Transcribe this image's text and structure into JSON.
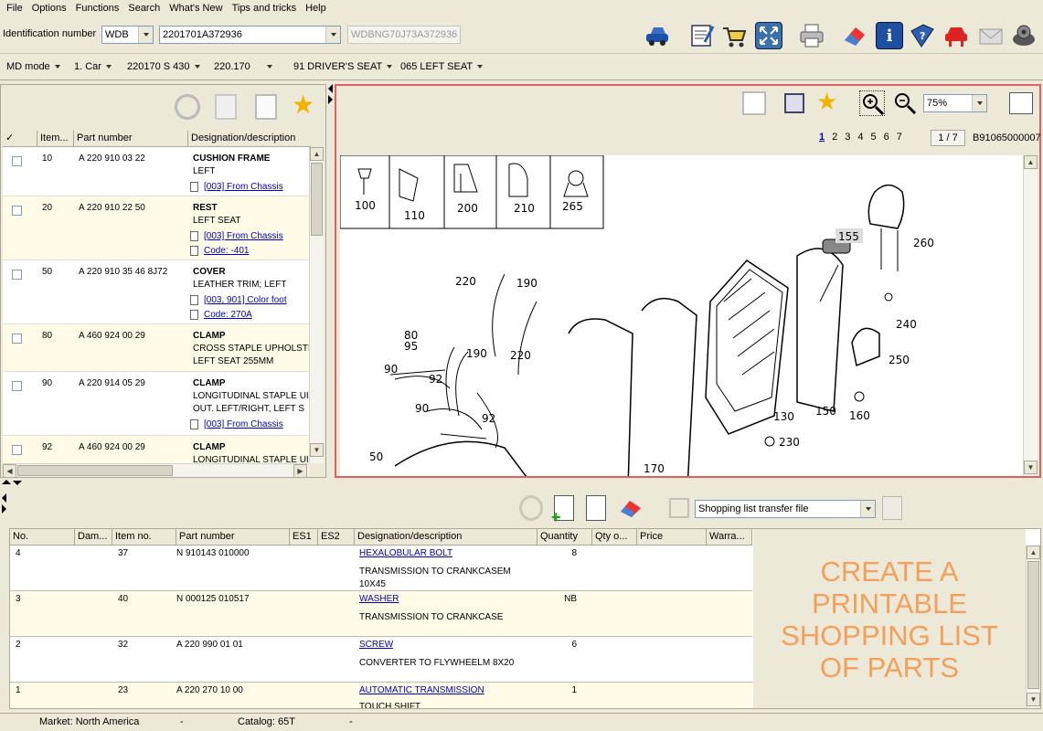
{
  "menu": [
    "File",
    "Options",
    "Functions",
    "Search",
    "What's New",
    "Tips and tricks",
    "Help"
  ],
  "ident": {
    "label": "Identification number",
    "prefix": "WDB",
    "value": "2201701A372936",
    "vin": "WDBNG70J73A372936"
  },
  "toolbar_icons": [
    "car-icon",
    "notepad-icon",
    "cart-icon",
    "fullscreen-icon",
    "print-icon",
    "eraser-icon",
    "info-icon",
    "help-book-icon",
    "service-car-icon",
    "mail-icon",
    "settings-icon"
  ],
  "modes": [
    "MD mode",
    "1. Car",
    "220170 S 430",
    "220.170",
    "91 DRIVER'S SEAT",
    "065 LEFT SEAT"
  ],
  "parts_table": {
    "headers": [
      "✓",
      "Item...",
      "Part number",
      "Designation/description"
    ],
    "rows": [
      {
        "item": "10",
        "part": "A 220 910 03 22",
        "title": "CUSHION FRAME",
        "lines": [
          "LEFT"
        ],
        "links": [
          "[003] From Chassis"
        ]
      },
      {
        "item": "20",
        "part": "A 220 910 22 50",
        "title": "REST",
        "lines": [
          "LEFT SEAT"
        ],
        "links": [
          "[003] From Chassis",
          "Code: -401"
        ]
      },
      {
        "item": "50",
        "part": "A 220 910 35 46 8J72",
        "title": "COVER",
        "lines": [
          "LEATHER TRIM; LEFT"
        ],
        "links": [
          "[003, 901] Color foot",
          "Code: 270A"
        ]
      },
      {
        "item": "80",
        "part": "A 460 924 00 29",
        "title": "CLAMP",
        "lines": [
          "CROSS STAPLE UPHOLSTE",
          "LEFT SEAT 255MM"
        ],
        "links": []
      },
      {
        "item": "90",
        "part": "A 220 914 05 29",
        "title": "CLAMP",
        "lines": [
          "LONGITUDINAL STAPLE UI",
          "OUT. LEFT/RIGHT, LEFT S"
        ],
        "links": [
          "[003] From Chassis"
        ]
      },
      {
        "item": "92",
        "part": "A 460 924 00 29",
        "title": "CLAMP",
        "lines": [
          "LONGITUDINAL STAPLE UI"
        ],
        "links": []
      }
    ]
  },
  "diagram": {
    "zoom": "75%",
    "pages": [
      "1",
      "2",
      "3",
      "4",
      "5",
      "6",
      "7"
    ],
    "page_indicator": "1 / 7",
    "doc_id": "B91065000007",
    "thumb_labels": [
      "100",
      "110",
      "200",
      "210",
      "265"
    ],
    "callouts": [
      "155",
      "260",
      "220",
      "190",
      "240",
      "80",
      "95",
      "190",
      "220",
      "250",
      "90",
      "92",
      "90",
      "92",
      "130",
      "150",
      "160",
      "230",
      "50",
      "170"
    ]
  },
  "shopping": {
    "transfer_label": "Shopping list transfer file",
    "headers": [
      "No.",
      "Dam...",
      "Item no.",
      "Part number",
      "ES1",
      "ES2",
      "Designation/description",
      "Quantity",
      "Qty o...",
      "Price",
      "Warra..."
    ],
    "rows": [
      {
        "no": "4",
        "item": "37",
        "part": "N 910143 010000",
        "name": "HEXALOBULAR BOLT",
        "desc": [
          "TRANSMISSION TO CRANKCASEM",
          "10X45"
        ],
        "qty": "8"
      },
      {
        "no": "3",
        "item": "40",
        "part": "N 000125 010517",
        "name": "WASHER",
        "desc": [
          "TRANSMISSION TO CRANKCASE"
        ],
        "qty": "NB"
      },
      {
        "no": "2",
        "item": "32",
        "part": "A 220 990 01 01",
        "name": "SCREW",
        "desc": [
          "CONVERTER TO FLYWHEELM 8X20"
        ],
        "qty": "6"
      },
      {
        "no": "1",
        "item": "23",
        "part": "A 220 270 10 00",
        "name": "AUTOMATIC TRANSMISSION",
        "desc": [
          "TOUCH SHIFT"
        ],
        "qty": "1"
      }
    ]
  },
  "promo": {
    "lines": [
      "CREATE A",
      "PRINTABLE",
      "SHOPPING LIST",
      "OF PARTS"
    ],
    "color": "#f5a05a"
  },
  "status": {
    "market": "Market: North America",
    "sep1": "-",
    "catalog": "Catalog: 65T",
    "sep2": "-"
  }
}
